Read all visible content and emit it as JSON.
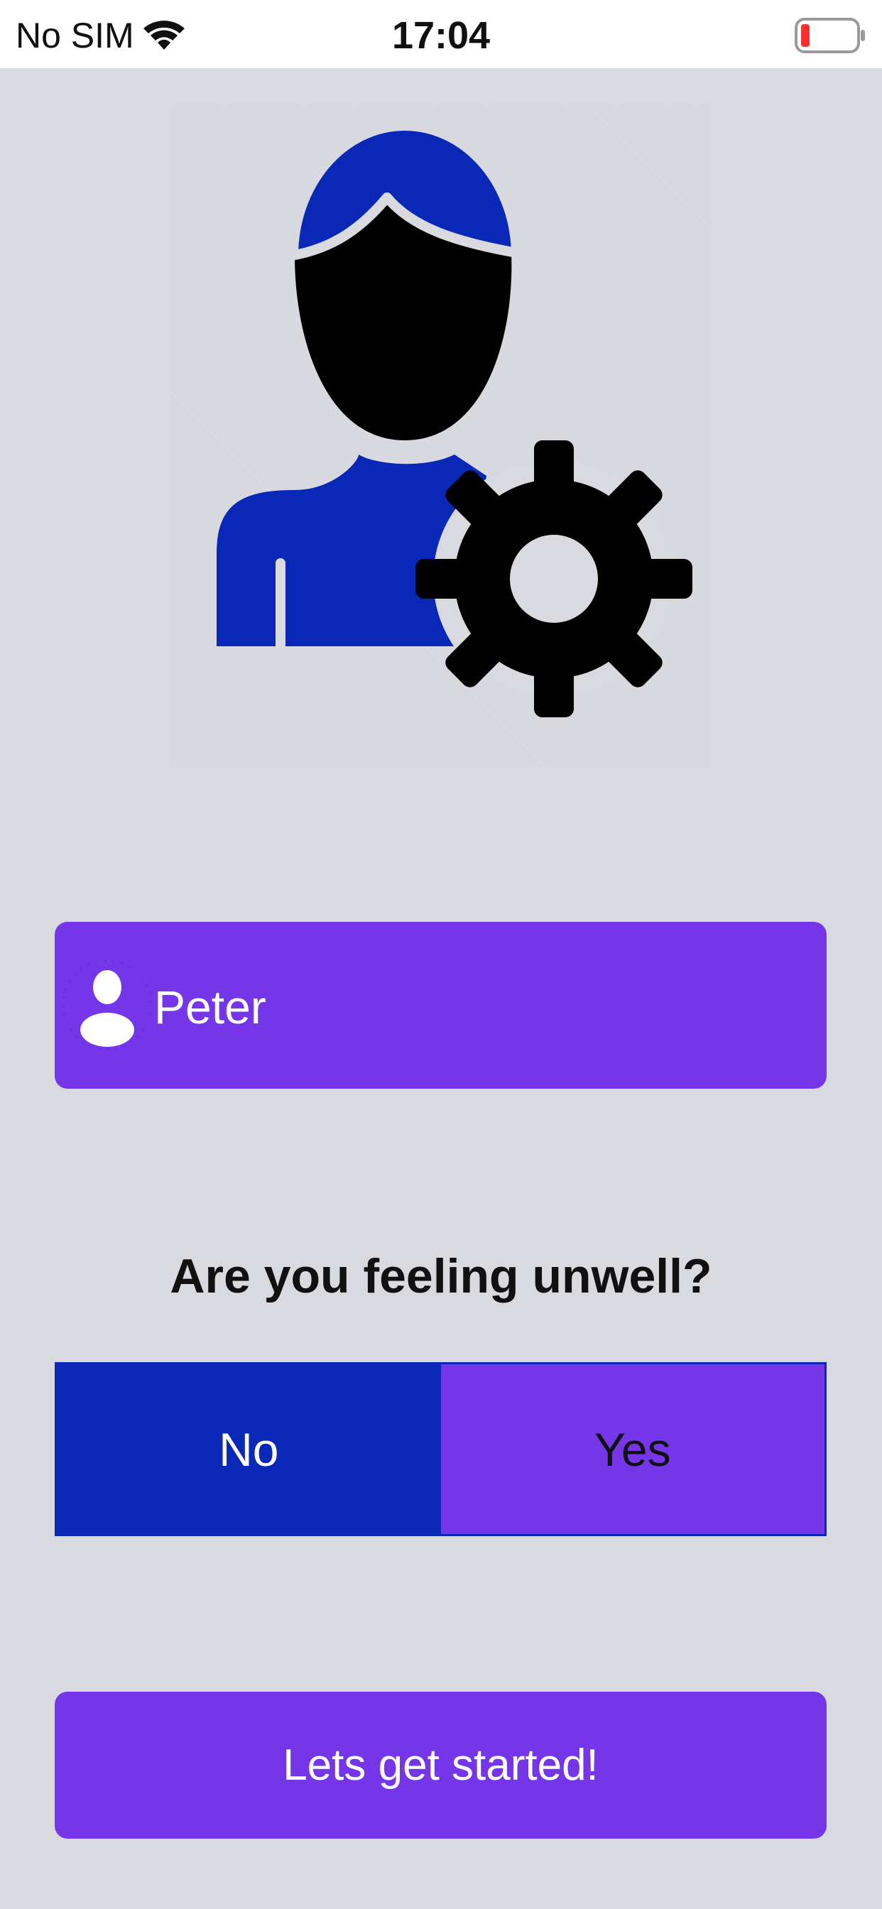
{
  "status_bar": {
    "carrier": "No SIM",
    "time": "17:04",
    "wifi_icon": "wifi-icon",
    "battery_icon": "battery-low-icon",
    "battery_level_fraction": 0.12
  },
  "hero": {
    "icon": "user-settings-icon",
    "colors": {
      "body": "#0a28b8",
      "face": "#000000",
      "gear": "#000000"
    }
  },
  "name_field": {
    "avatar_icon": "user-avatar-icon",
    "value": "Peter"
  },
  "question": {
    "text": "Are you feeling unwell?",
    "options": [
      {
        "label": "No",
        "selected": true
      },
      {
        "label": "Yes",
        "selected": false
      }
    ]
  },
  "start_button": {
    "label": "Lets get started!"
  },
  "colors": {
    "background": "#d8dae0",
    "accent_purple": "#7536ea",
    "accent_blue": "#0a28b8"
  }
}
